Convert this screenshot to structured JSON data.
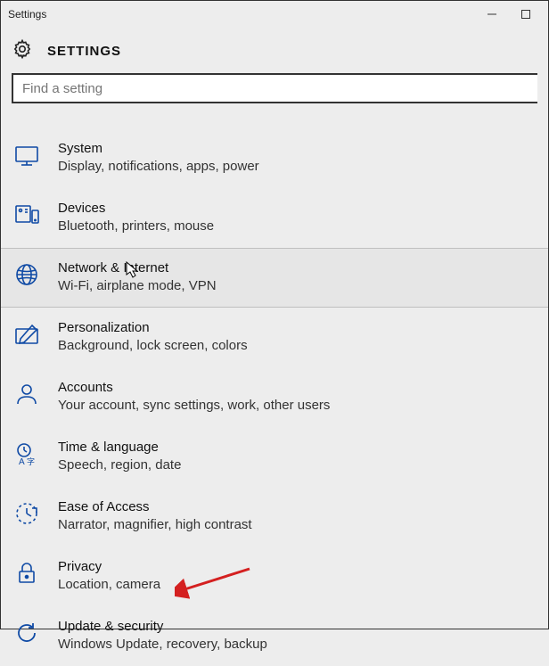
{
  "window": {
    "title": "Settings"
  },
  "header": {
    "title": "SETTINGS"
  },
  "search": {
    "placeholder": "Find a setting"
  },
  "categories": [
    {
      "title": "System",
      "desc": "Display, notifications, apps, power",
      "icon": "system-icon"
    },
    {
      "title": "Devices",
      "desc": "Bluetooth, printers, mouse",
      "icon": "devices-icon"
    },
    {
      "title": "Network & Internet",
      "desc": "Wi-Fi, airplane mode, VPN",
      "icon": "network-icon",
      "hovered": true
    },
    {
      "title": "Personalization",
      "desc": "Background, lock screen, colors",
      "icon": "personalization-icon"
    },
    {
      "title": "Accounts",
      "desc": "Your account, sync settings, work, other users",
      "icon": "accounts-icon"
    },
    {
      "title": "Time & language",
      "desc": "Speech, region, date",
      "icon": "time-language-icon"
    },
    {
      "title": "Ease of Access",
      "desc": "Narrator, magnifier, high contrast",
      "icon": "ease-of-access-icon"
    },
    {
      "title": "Privacy",
      "desc": "Location, camera",
      "icon": "privacy-icon"
    },
    {
      "title": "Update & security",
      "desc": "Windows Update, recovery, backup",
      "icon": "update-security-icon"
    }
  ],
  "annotation": {
    "arrow_target": "Update & security",
    "arrow_color": "#d42020"
  }
}
